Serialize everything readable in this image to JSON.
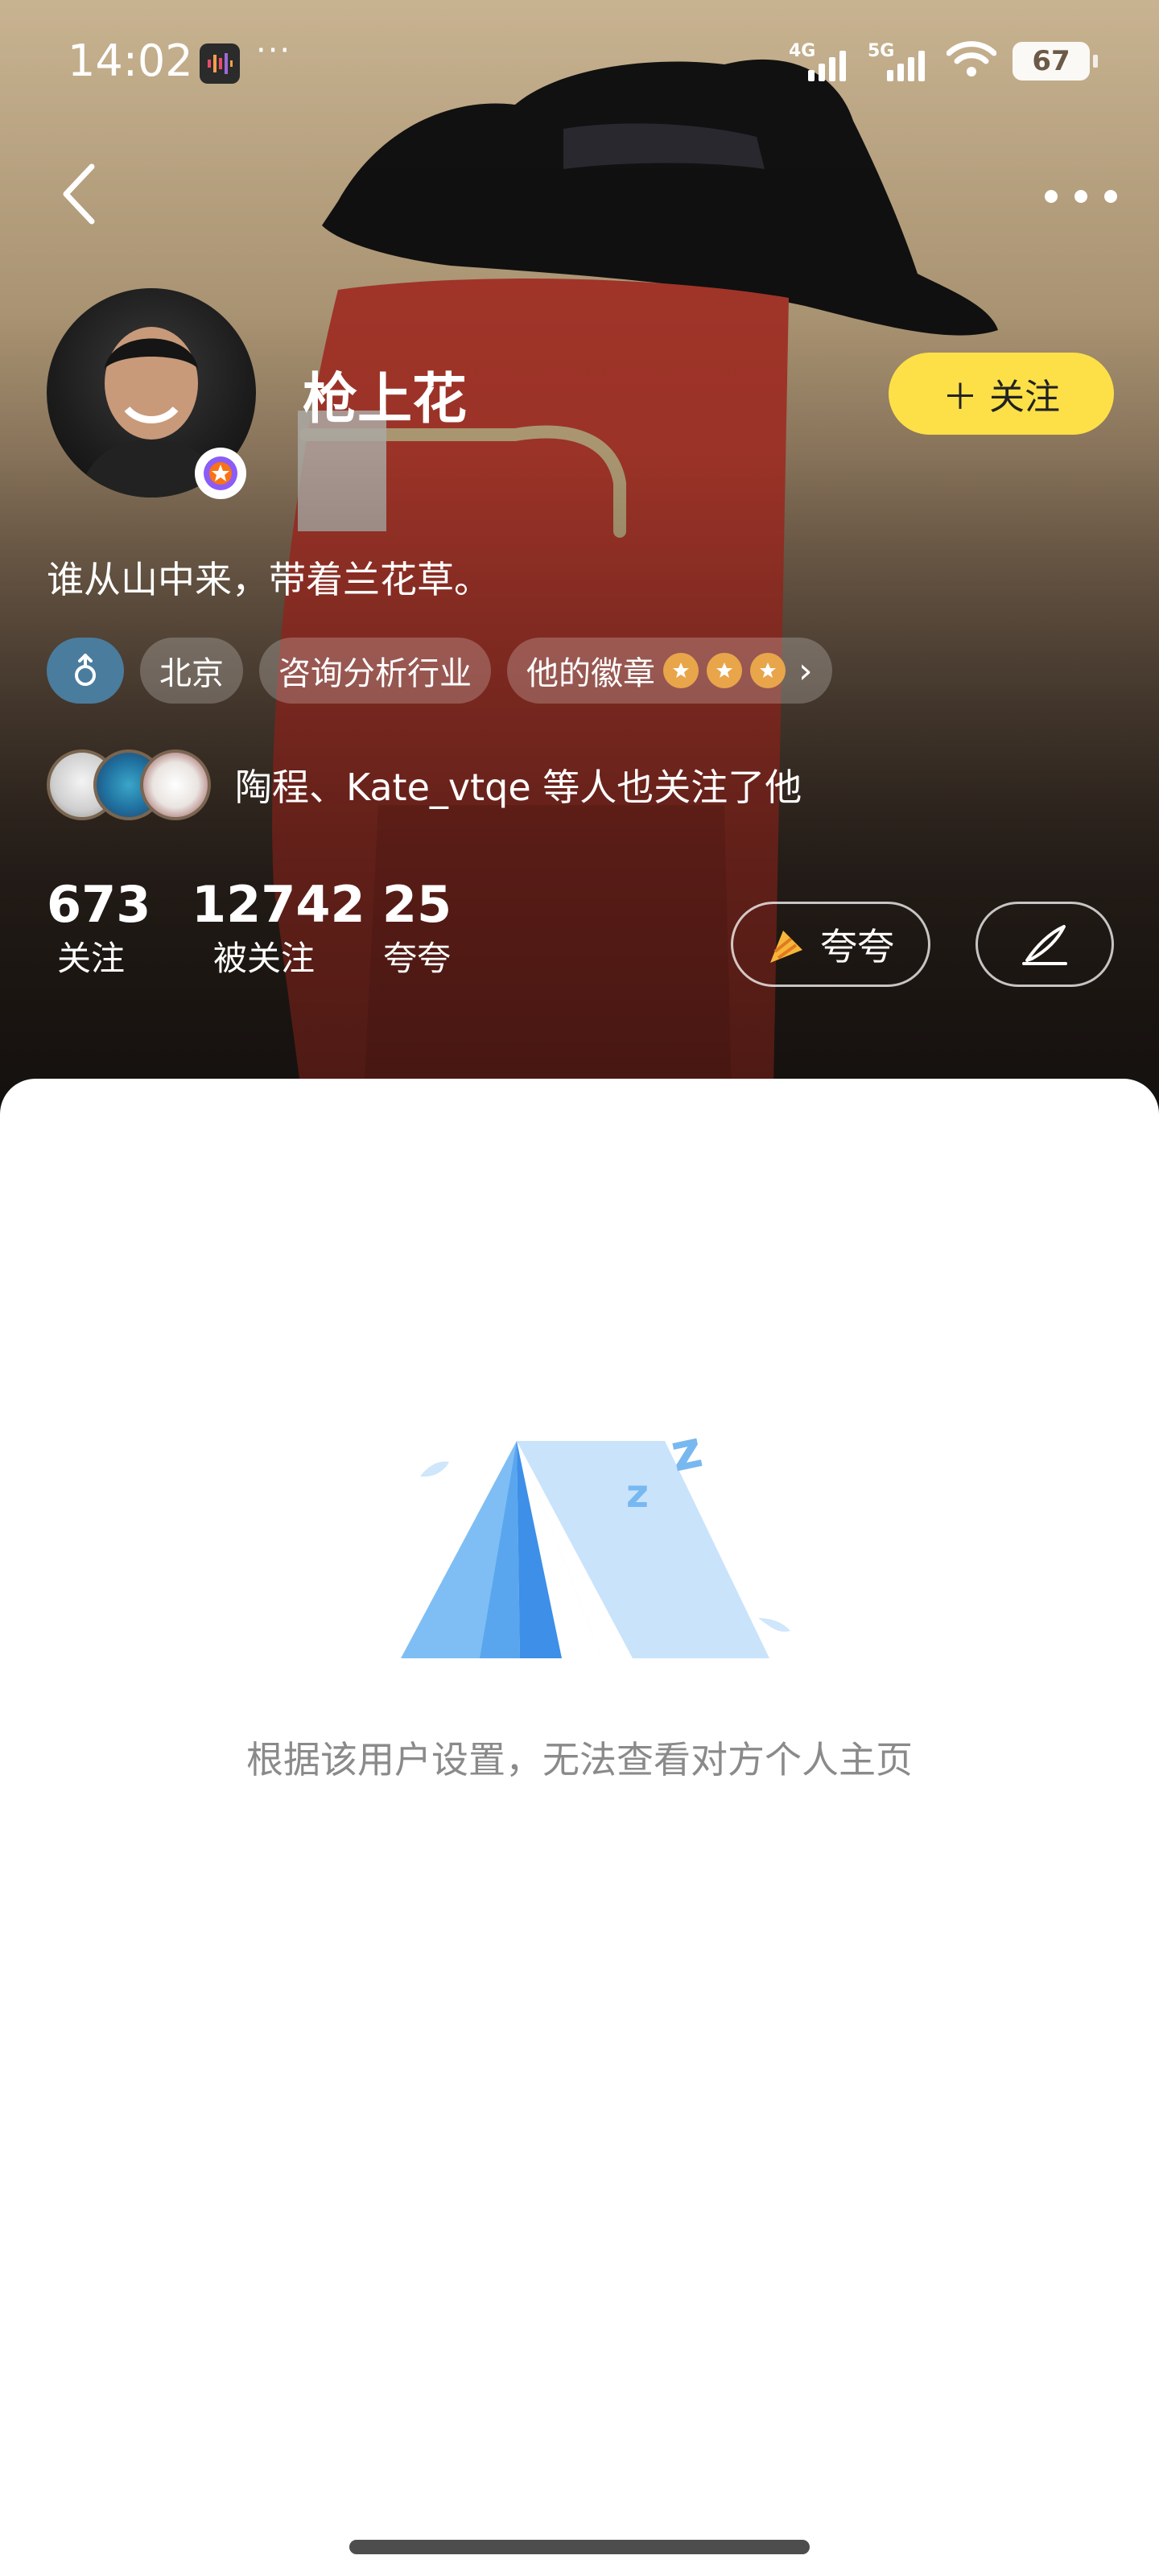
{
  "status_bar": {
    "time": "14:02",
    "more": "···",
    "network_1": "4G",
    "network_2": "5G",
    "battery": "67",
    "icons": [
      "app-notification-icon",
      "signal-icon",
      "wifi-icon",
      "battery-icon"
    ]
  },
  "nav": {
    "back_icon": "chevron-left-icon",
    "more_icon": "more-dots-icon"
  },
  "profile": {
    "name": "枪上花",
    "follow_label": "＋ 关注",
    "bio": "谁从山中来，带着兰花草。",
    "tags": {
      "gender_icon": "male-icon",
      "city": "北京",
      "industry": "咨询分析行业",
      "badges": "他的徽章",
      "badge_count": 3,
      "badge_arrow": "›"
    },
    "mutual": "陶程、Kate_vtqe 等人也关注了他",
    "stats": [
      {
        "value": "673",
        "label": "关注"
      },
      {
        "value": "12742",
        "label": "被关注"
      },
      {
        "value": "25",
        "label": "夸夸"
      }
    ],
    "kuakua_label": "夸夸",
    "sign_icon": "quill-pen-icon"
  },
  "content": {
    "empty_icon": "tent-sleeping-icon",
    "empty_message": "根据该用户设置，无法查看对方个人主页"
  },
  "colors": {
    "accent_yellow": "#fde047",
    "gender_blue": "#4a7c9e",
    "tent_light": "#b9dcf8",
    "tent_dark": "#4a9cf0",
    "message_gray": "#8a8a8a"
  }
}
